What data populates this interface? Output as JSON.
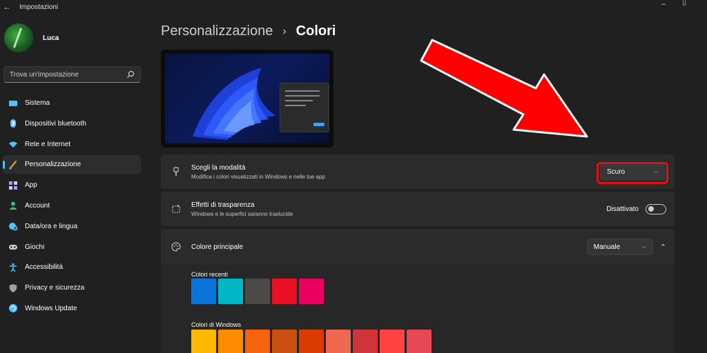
{
  "window": {
    "title": "Impostazioni"
  },
  "profile": {
    "name": "Luca"
  },
  "search": {
    "placeholder": "Trova un'impostazione"
  },
  "sidebar": {
    "items": [
      {
        "label": "Sistema",
        "icon": "monitor-icon",
        "color": "#4cc2ff"
      },
      {
        "label": "Dispositivi bluetooth",
        "icon": "bluetooth-icon",
        "color": "#4cc2ff"
      },
      {
        "label": "Rete e Internet",
        "icon": "wifi-icon",
        "color": "#4cc2ff"
      },
      {
        "label": "Personalizzazione",
        "icon": "brush-icon",
        "color": "#f0a030",
        "active": true
      },
      {
        "label": "App",
        "icon": "apps-icon",
        "color": "#a0a0ff"
      },
      {
        "label": "Account",
        "icon": "person-icon",
        "color": "#3cc08a"
      },
      {
        "label": "Data/ora e lingua",
        "icon": "globe-clock-icon",
        "color": "#4cc2ff"
      },
      {
        "label": "Giochi",
        "icon": "gamepad-icon",
        "color": "#cccccc"
      },
      {
        "label": "Accessibilità",
        "icon": "accessibility-icon",
        "color": "#4cc2ff"
      },
      {
        "label": "Privacy e sicurezza",
        "icon": "shield-icon",
        "color": "#a0a0a0"
      },
      {
        "label": "Windows Update",
        "icon": "update-icon",
        "color": "#4cc2ff"
      }
    ]
  },
  "breadcrumb": {
    "parent": "Personalizzazione",
    "separator": "›",
    "current": "Colori"
  },
  "mode_card": {
    "title": "Scegli la modalità",
    "subtitle": "Modifica i colori visualizzati in Windows e nelle tue app",
    "value": "Scuro"
  },
  "transparency_card": {
    "title": "Effetti di trasparenza",
    "subtitle": "Windows e le superfici saranno traslucide",
    "state_label": "Disattivato",
    "on": false
  },
  "accent_card": {
    "title": "Colore principale",
    "value": "Manuale"
  },
  "recent_colors": {
    "label": "Colori recenti",
    "swatches": [
      "#0a74da",
      "#00b7c3",
      "#4c4a48",
      "#e81123",
      "#ea005e"
    ]
  },
  "windows_colors": {
    "label": "Colori di Windows",
    "swatches": [
      "#ffb900",
      "#ff8c00",
      "#f7630c",
      "#ca5010",
      "#da3b01",
      "#ef6950",
      "#d13438",
      "#ff4343",
      "#e74856"
    ]
  },
  "accent_color": "#4cc2ff",
  "annotation_color": "#ff0000"
}
